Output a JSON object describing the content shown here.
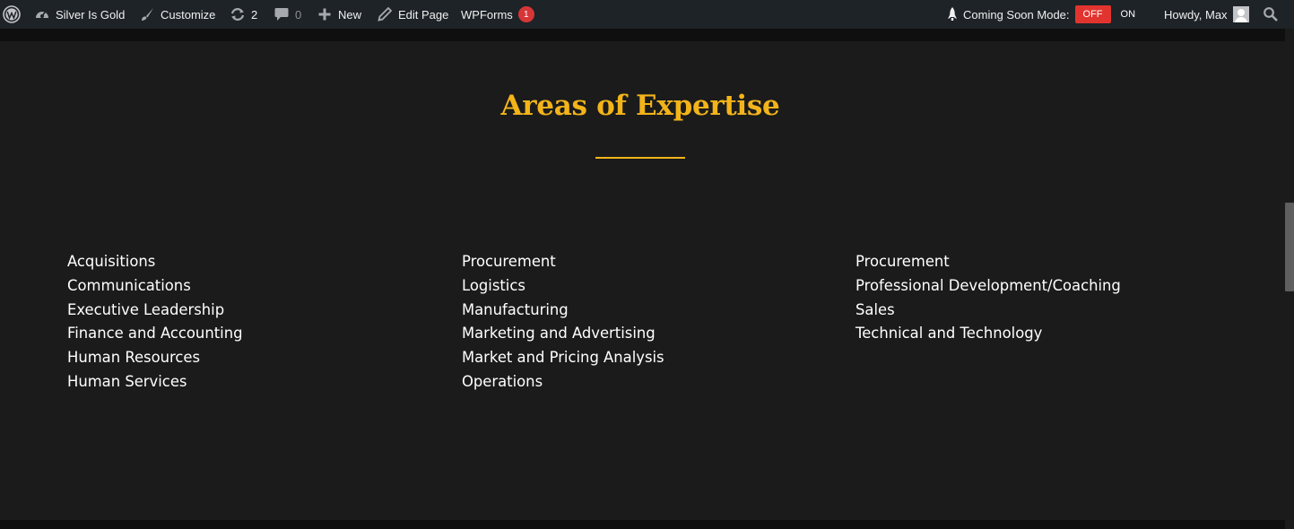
{
  "admin_bar": {
    "site_name": "Silver Is Gold",
    "customize": "Customize",
    "updates_count": "2",
    "comments_count": "0",
    "new": "New",
    "edit_page": "Edit Page",
    "wpforms": "WPForms",
    "wpforms_badge": "1",
    "coming_soon_label": "Coming Soon Mode:",
    "toggle_off": "OFF",
    "toggle_on": "ON",
    "howdy": "Howdy, Max"
  },
  "section": {
    "title": "Areas of Expertise",
    "columns": [
      [
        "Acquisitions",
        "Communications",
        "Executive Leadership",
        "Finance and Accounting",
        "Human Resources",
        "Human Services"
      ],
      [
        "Procurement",
        "Logistics",
        "Manufacturing",
        "Marketing and Advertising",
        "Market and Pricing Analysis",
        "Operations"
      ],
      [
        "Procurement",
        "Professional Development/Coaching",
        "Sales",
        "Technical and Technology"
      ]
    ]
  },
  "colors": {
    "accent_gold": "#f3b41a",
    "admin_bar_bg": "#1d2327",
    "content_bg": "#1b1b1b",
    "toggle_off_bg": "#e2342f",
    "badge_red": "#d63638"
  },
  "icons": [
    "wordpress-logo-icon",
    "dashboard-icon",
    "brush-icon",
    "updates-icon",
    "comment-icon",
    "plus-icon",
    "pencil-icon",
    "rocket-icon",
    "search-icon"
  ]
}
